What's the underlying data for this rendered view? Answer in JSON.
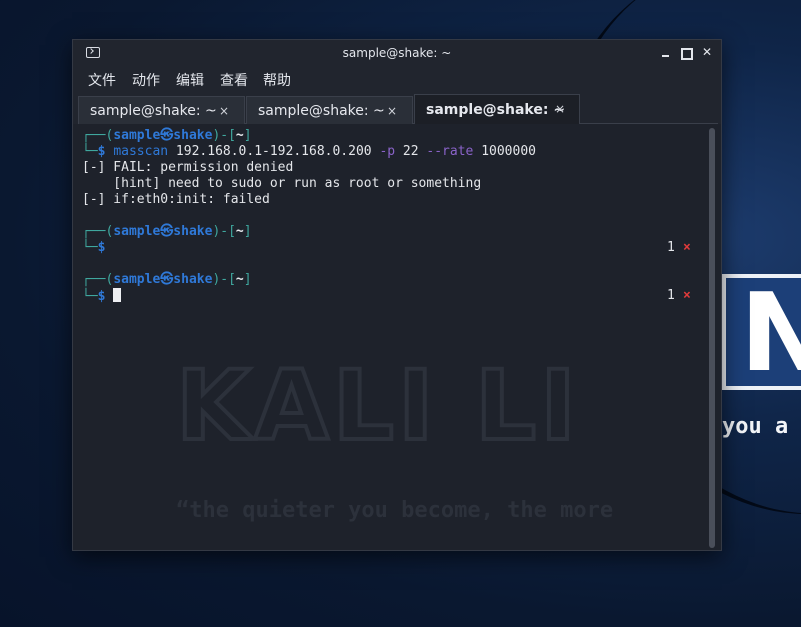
{
  "window": {
    "title": "sample@shake: ~"
  },
  "menu": [
    "文件",
    "动作",
    "编辑",
    "查看",
    "帮助"
  ],
  "tabs": [
    {
      "label": "sample@shake: ~",
      "close": "×",
      "active": false
    },
    {
      "label": "sample@shake: ~",
      "close": "×",
      "active": false
    },
    {
      "label": "sample@shake: ~",
      "close": "×",
      "active": true
    }
  ],
  "prompt": {
    "frame_top": "┌──(",
    "user": "sample",
    "at": "㉿",
    "host": "shake",
    "mid": ")-[",
    "dir": "~",
    "end": "]",
    "frame_bottom": "└─",
    "dollar": "$"
  },
  "terminal": {
    "command": "masscan",
    "args1": " 192.168.0.1-192.168.0.200 ",
    "flag1": "-p",
    "args2": " 22 ",
    "flag2": "--rate",
    "args3": " 1000000",
    "output": [
      "[-] FAIL: permission denied",
      "    [hint] need to sudo or run as root or something",
      "[-] if:eth0:init: failed"
    ],
    "exit_status": [
      {
        "num": "1",
        "mark": "×"
      },
      {
        "num": "1",
        "mark": "×"
      }
    ]
  },
  "wallpaper": {
    "logo_text": "KALI LINUX",
    "quote": "“the quieter you become, the more you are able to hear”",
    "visible_quote": "you a"
  },
  "colors": {
    "prompt_blue": "#2f79d8",
    "frame_teal": "#3fa79e",
    "flag_purple": "#8a63c9",
    "error_red": "#e23b3b",
    "terminal_bg": "#1e222b"
  }
}
